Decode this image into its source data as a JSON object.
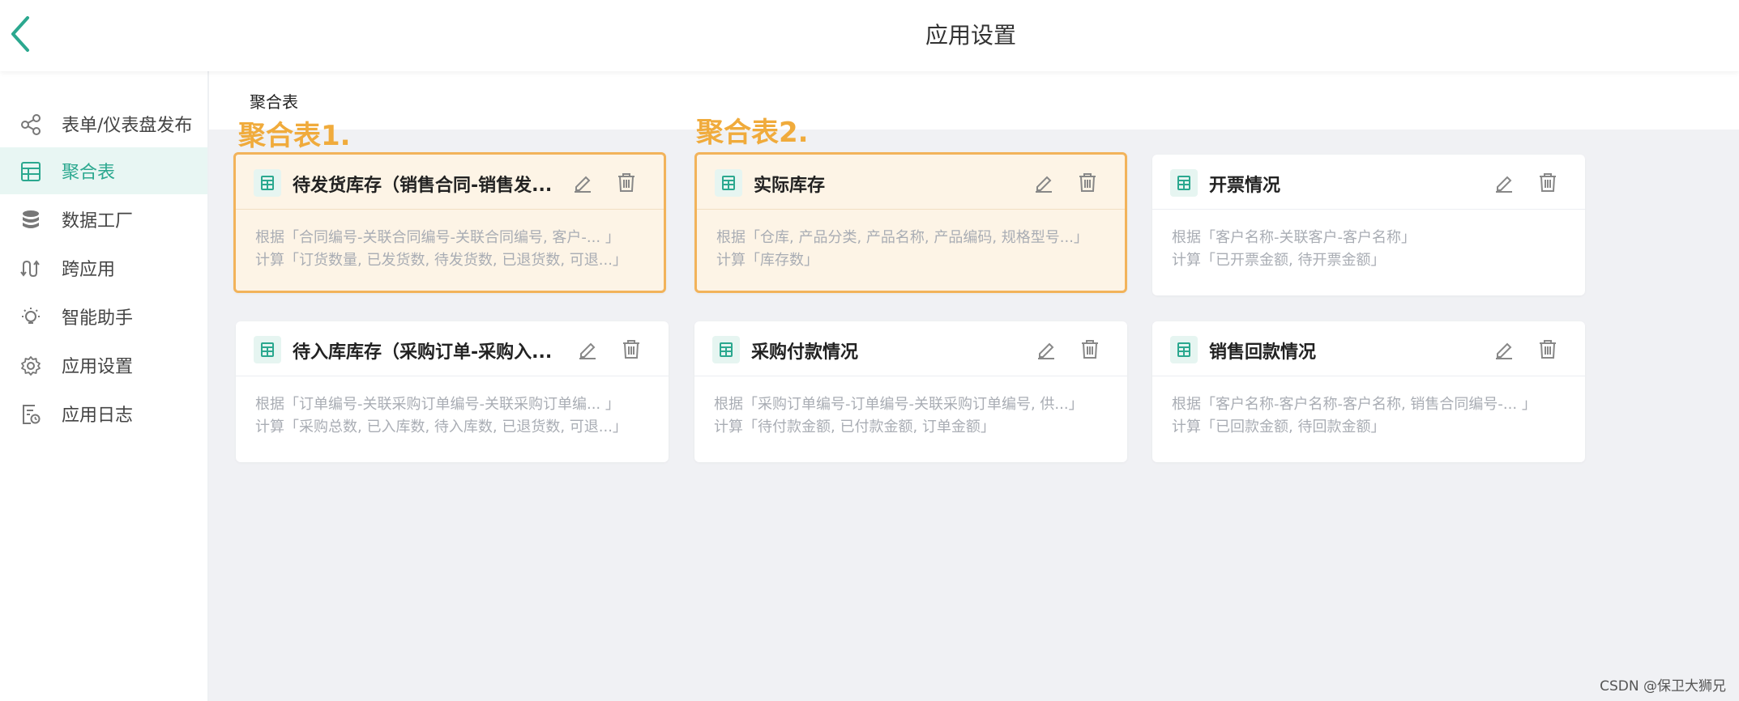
{
  "header": {
    "title": "应用设置",
    "back_icon": "chevron-left-icon",
    "accent": "#2ba88f"
  },
  "sidebar": {
    "items": [
      {
        "label": "表单/仪表盘发布",
        "icon": "share-icon",
        "active": false
      },
      {
        "label": "聚合表",
        "icon": "table-icon",
        "active": true
      },
      {
        "label": "数据工厂",
        "icon": "database-icon",
        "active": false
      },
      {
        "label": "跨应用",
        "icon": "link-icon",
        "active": false
      },
      {
        "label": "智能助手",
        "icon": "lightbulb-icon",
        "active": false
      },
      {
        "label": "应用设置",
        "icon": "gear-icon",
        "active": false
      },
      {
        "label": "应用日志",
        "icon": "log-icon",
        "active": false
      }
    ]
  },
  "main": {
    "section_label": "聚合表",
    "annotations": [
      "聚合表1.",
      "聚合表2."
    ],
    "cards": [
      {
        "title": "待发货库存（销售合同-销售发...",
        "line1": "根据「合同编号-关联合同编号-关联合同编号, 客户-... 」",
        "line2": "计算「订货数量, 已发货数, 待发货数, 已退货数, 可退...」",
        "highlighted": true
      },
      {
        "title": "实际库存",
        "line1": "根据「仓库, 产品分类, 产品名称, 产品编码, 规格型号...」",
        "line2": "计算「库存数」",
        "highlighted": true
      },
      {
        "title": "开票情况",
        "line1": "根据「客户名称-关联客户-客户名称」",
        "line2": "计算「已开票金额, 待开票金额」",
        "highlighted": false
      },
      {
        "title": "待入库库存（采购订单-采购入...",
        "line1": "根据「订单编号-关联采购订单编号-关联采购订单编... 」",
        "line2": "计算「采购总数, 已入库数, 待入库数, 已退货数, 可退...」",
        "highlighted": false
      },
      {
        "title": "采购付款情况",
        "line1": "根据「采购订单编号-订单编号-关联采购订单编号, 供...」",
        "line2": "计算「待付款金额, 已付款金额, 订单金额」",
        "highlighted": false
      },
      {
        "title": "销售回款情况",
        "line1": "根据「客户名称-客户名称-客户名称, 销售合同编号-... 」",
        "line2": "计算「已回款金额, 待回款金额」",
        "highlighted": false
      }
    ]
  },
  "watermark": "CSDN @保卫大狮兄",
  "colors": {
    "highlight_border": "#f2b35a",
    "highlight_bg": "#fdf4e6",
    "annotation": "#f0ab3c"
  }
}
